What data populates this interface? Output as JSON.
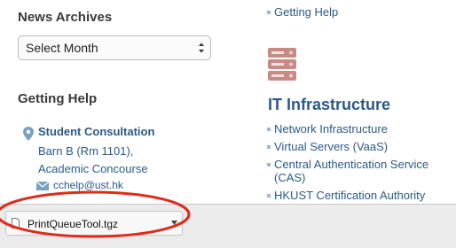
{
  "news_archives": {
    "title": "News Archives",
    "select_value": "Select Month"
  },
  "getting_help": {
    "title": "Getting Help",
    "contact_name": "Student Consultation",
    "address_line1": "Barn B (Rm 1101),",
    "address_line2": "Academic Concourse",
    "email": "cchelp@ust.hk"
  },
  "right_column": {
    "top_link": "Getting Help",
    "section_title": "IT Infrastructure",
    "links": [
      "Network Infrastructure",
      "Virtual Servers (VaaS)",
      "Central Authentication Service",
      "(CAS)",
      "HKUST Certification Authority"
    ]
  },
  "download_bar": {
    "file_name": "PrintQueueTool.tgz"
  },
  "colors": {
    "link": "#2a5a8a",
    "heading": "#3a3a3a",
    "icon_accent": "#c98a85",
    "annotation": "#e02a1a"
  }
}
